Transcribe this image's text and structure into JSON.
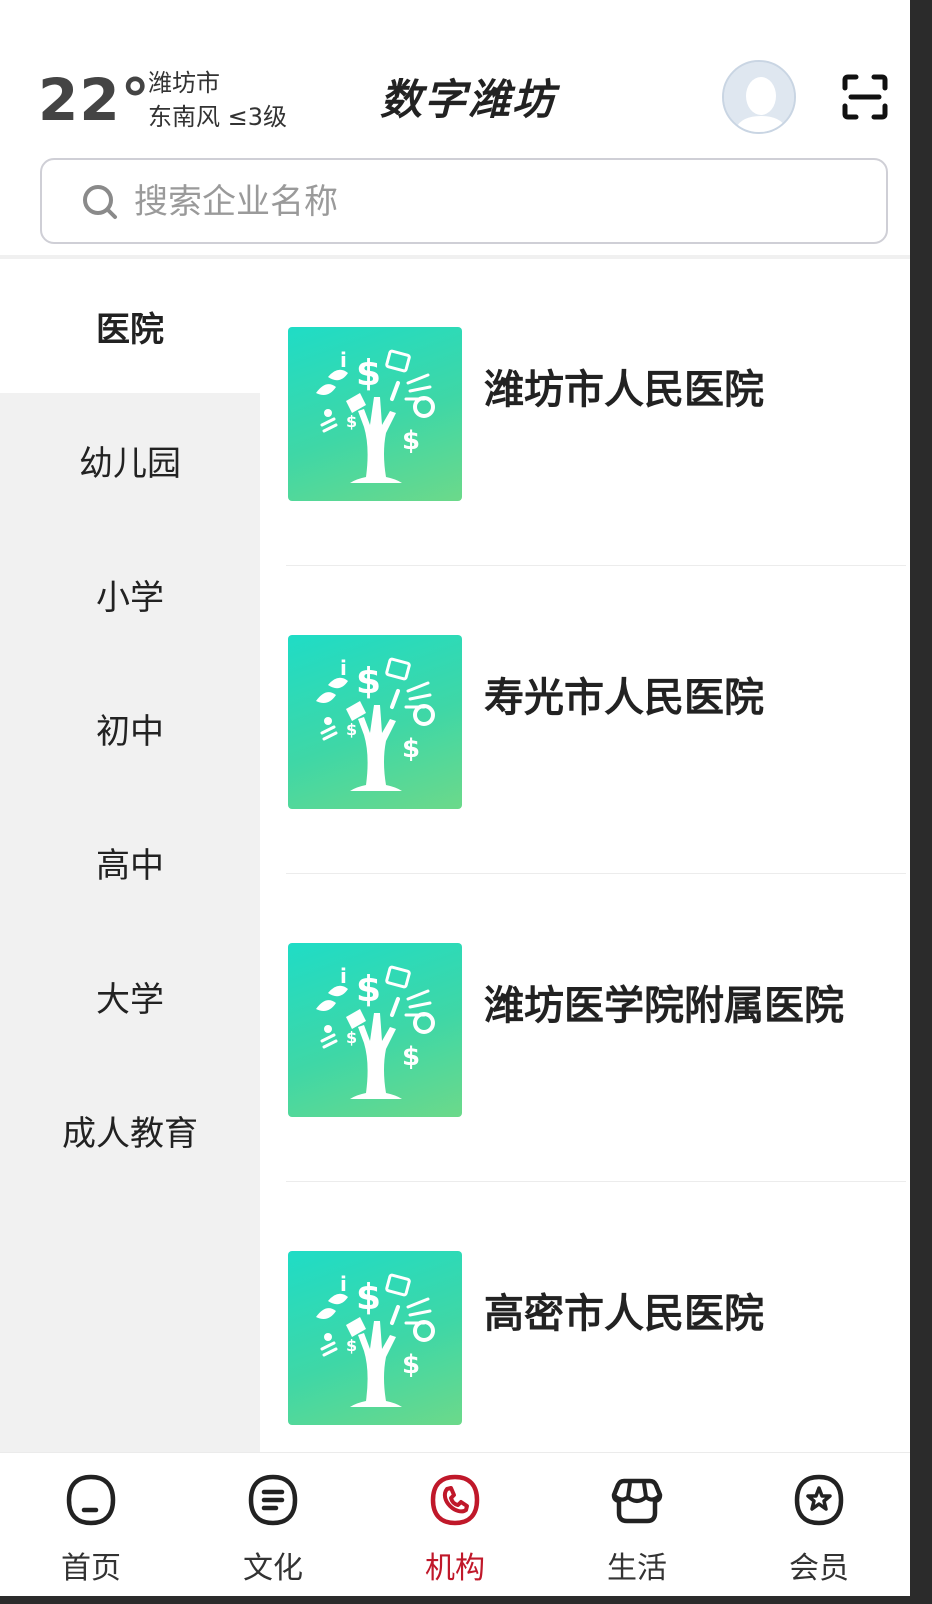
{
  "header": {
    "temperature": "22°",
    "city": "潍坊市",
    "wind": "东南风 ≤3级",
    "app_title": "数字潍坊"
  },
  "search": {
    "placeholder": "搜索企业名称",
    "value": ""
  },
  "categories": [
    {
      "label": "医院",
      "active": true
    },
    {
      "label": "幼儿园",
      "active": false
    },
    {
      "label": "小学",
      "active": false
    },
    {
      "label": "初中",
      "active": false
    },
    {
      "label": "高中",
      "active": false
    },
    {
      "label": "大学",
      "active": false
    },
    {
      "label": "成人教育",
      "active": false
    }
  ],
  "institutions": [
    {
      "name": "潍坊市人民医院",
      "icon": "money-tree-icon"
    },
    {
      "name": "寿光市人民医院",
      "icon": "money-tree-icon"
    },
    {
      "name": "潍坊医学院附属医院",
      "icon": "money-tree-icon"
    },
    {
      "name": "高密市人民医院",
      "icon": "money-tree-icon"
    }
  ],
  "bottom_nav": [
    {
      "label": "首页",
      "icon": "home-face-icon",
      "active": false
    },
    {
      "label": "文化",
      "icon": "document-lines-icon",
      "active": false
    },
    {
      "label": "机构",
      "icon": "phone-icon",
      "active": true
    },
    {
      "label": "生活",
      "icon": "shop-icon",
      "active": false
    },
    {
      "label": "会员",
      "icon": "star-badge-icon",
      "active": false
    }
  ],
  "colors": {
    "accent": "#c0182a",
    "thumbnail_gradient_start": "#1fdcc6",
    "thumbnail_gradient_end": "#6cd98a",
    "sidebar_bg": "#f1f1f1"
  }
}
